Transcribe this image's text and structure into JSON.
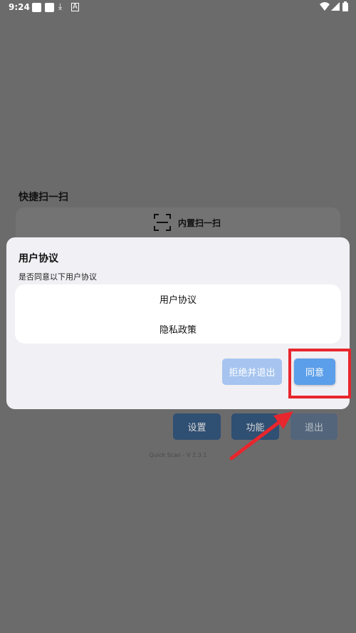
{
  "status_bar": {
    "time": "9:24"
  },
  "background": {
    "quick_scan_title": "快捷扫一扫",
    "builtin_scan_label": "内置扫一扫",
    "buttons": {
      "settings": "设置",
      "functions": "功能",
      "exit": "退出"
    },
    "version": "Quick Scan - V 2.3.1"
  },
  "dialog": {
    "title": "用户协议",
    "message": "是否同意以下用户协议",
    "items": [
      {
        "label": "用户协议"
      },
      {
        "label": "隐私政策"
      }
    ],
    "reject_label": "拒绝并退出",
    "agree_label": "同意"
  },
  "colors": {
    "accent": "#5b9ee9",
    "accent_disabled": "#a6c4ef",
    "annotation": "#e8262d"
  }
}
